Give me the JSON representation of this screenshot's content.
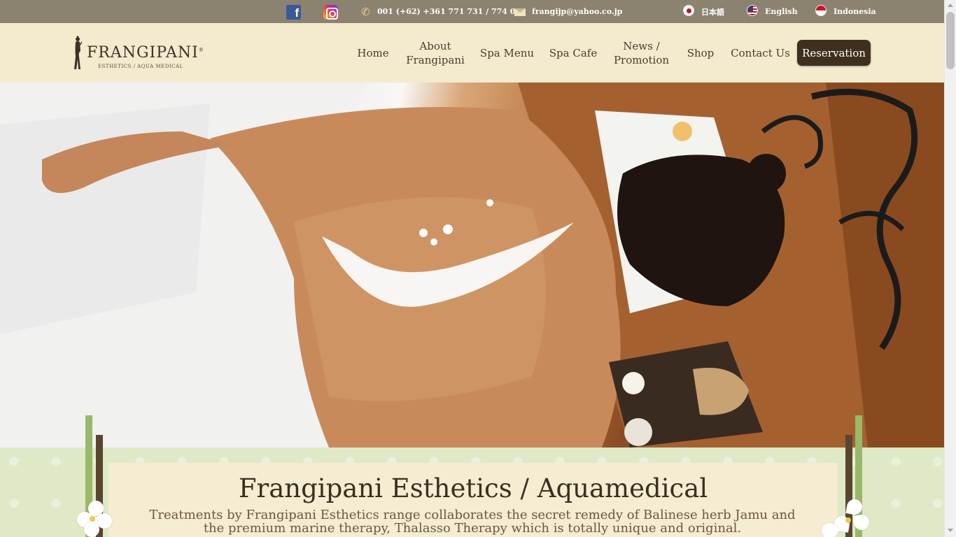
{
  "topbar": {
    "phone": "001 (+62) +361 771 731 / 774 005",
    "email": "frangijp@yahoo.co.jp",
    "languages": [
      {
        "label": "日本語",
        "flag": "japan-flag-icon"
      },
      {
        "label": "English",
        "flag": "us-flag-icon"
      },
      {
        "label": "Indonesia",
        "flag": "indonesia-flag-icon"
      }
    ],
    "social": [
      "facebook-icon",
      "instagram-icon"
    ]
  },
  "header": {
    "logo": {
      "name": "FRANGIPANI",
      "registered": "®",
      "tagline": "ESTHETICS / AQUA MEDICAL"
    },
    "nav": [
      {
        "label": "Home"
      },
      {
        "label": "About\nFrangipani"
      },
      {
        "label": "Spa Menu"
      },
      {
        "label": "Spa Cafe"
      },
      {
        "label": "News /\nPromotion"
      },
      {
        "label": "Shop"
      },
      {
        "label": "Contact Us"
      }
    ],
    "reservation_label": "Reservation"
  },
  "intro": {
    "title": "Frangipani Esthetics / Aquamedical",
    "text": "Treatments by Frangipani Esthetics range collaborates the secret remedy of Balinese herb Jamu and the premium marine therapy, Thalasso Therapy which is totally unique and original."
  },
  "colors": {
    "topbar": "#8b8270",
    "header": "#f4ebcf",
    "button": "#3f2f1e",
    "intro_bg": "#dfe9c7",
    "panel": "#f6ecd1",
    "accent_green": "#9ab86a"
  }
}
